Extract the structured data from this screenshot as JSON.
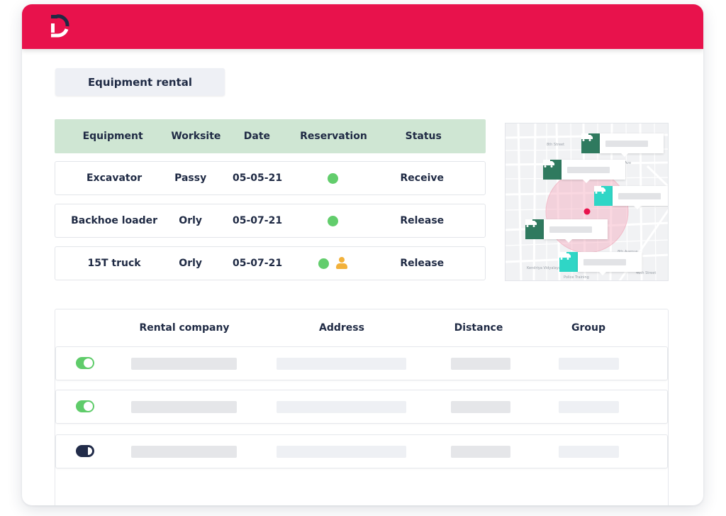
{
  "app": {
    "brand_color": "#e8124c",
    "logo": "D-logo"
  },
  "page_title": "Equipment rental",
  "reservations": {
    "header_bg": "#cfe6d3",
    "columns": [
      "Equipment",
      "Worksite",
      "Date",
      "Reservation",
      "Status"
    ],
    "rows": [
      {
        "equipment": "Excavator",
        "worksite": "Passy",
        "date": "05-05-21",
        "reservation": [
          "green-dot"
        ],
        "status": "Receive"
      },
      {
        "equipment": "Backhoe loader",
        "worksite": "Orly",
        "date": "05-07-21",
        "reservation": [
          "green-dot"
        ],
        "status": "Release"
      },
      {
        "equipment": "15T truck",
        "worksite": "Orly",
        "date": "05-07-21",
        "reservation": [
          "green-dot",
          "person-icon"
        ],
        "status": "Release"
      }
    ],
    "status_colors": {
      "green-dot": "#62cd6c",
      "person-icon": "#f2b13b"
    }
  },
  "map": {
    "street_labels": [
      "8th Street",
      "3rd Ave",
      "8th Avenue",
      "46th Street",
      "Kendriya Vidyalaya",
      "Police Training"
    ],
    "markers": [
      {
        "icon": "truck-icon",
        "style": "dark"
      },
      {
        "icon": "truck-icon",
        "style": "dark"
      },
      {
        "icon": "truck-icon",
        "style": "teal"
      },
      {
        "icon": "truck-icon",
        "style": "dark"
      },
      {
        "icon": "truck-icon",
        "style": "teal"
      }
    ],
    "colors": {
      "dark": "#2f7a5f",
      "teal": "#2fd6c6",
      "radius": "#f6c9d4",
      "center": "#e8124c"
    }
  },
  "companies": {
    "columns": [
      "Rental company",
      "Address",
      "Distance",
      "Group"
    ],
    "rows": [
      {
        "enabled": true,
        "toggle_style": "green"
      },
      {
        "enabled": true,
        "toggle_style": "green"
      },
      {
        "enabled": false,
        "toggle_style": "dark"
      }
    ]
  }
}
